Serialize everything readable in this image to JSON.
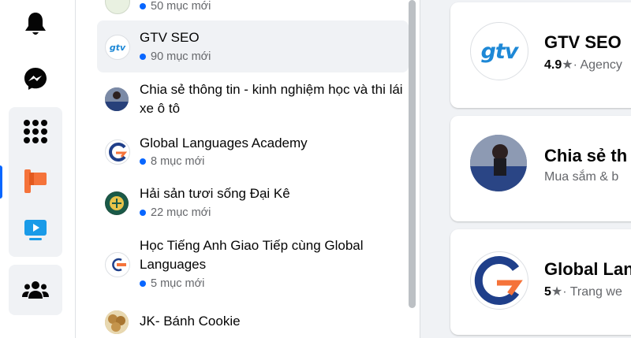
{
  "pages_list": {
    "items": [
      {
        "title": "",
        "badge": "50 mục mới"
      },
      {
        "title": "GTV SEO",
        "badge": "90 mục mới"
      },
      {
        "title": "Chia sẻ thông tin - kinh nghiệm học và thi lái xe ô tô",
        "badge": ""
      },
      {
        "title": "Global Languages Academy",
        "badge": "8 mục mới"
      },
      {
        "title": "Hải sản tươi sống Đại Kê",
        "badge": "22 mục mới"
      },
      {
        "title": "Học Tiếng Anh Giao Tiếp cùng Global Languages",
        "badge": "5 mục mới"
      },
      {
        "title": "JK- Bánh Cookie",
        "badge": ""
      }
    ]
  },
  "cards": [
    {
      "title": "GTV SEO",
      "rating": "4.9",
      "category": "· Agency"
    },
    {
      "title": "Chia sẻ th",
      "category": "Mua sắm & b"
    },
    {
      "title": "Global Lan",
      "rating": "5",
      "category": "· Trang we"
    }
  ],
  "logos": {
    "gtv": "gtv"
  },
  "colors": {
    "accent": "#0866ff",
    "notification_blue": "#0866ff",
    "page_bg": "#f0f2f5",
    "orange": "#f5733a"
  },
  "icons": [
    "bell-icon",
    "messenger-icon",
    "grid-menu-icon",
    "pages-flag-icon",
    "video-icon",
    "groups-icon"
  ]
}
